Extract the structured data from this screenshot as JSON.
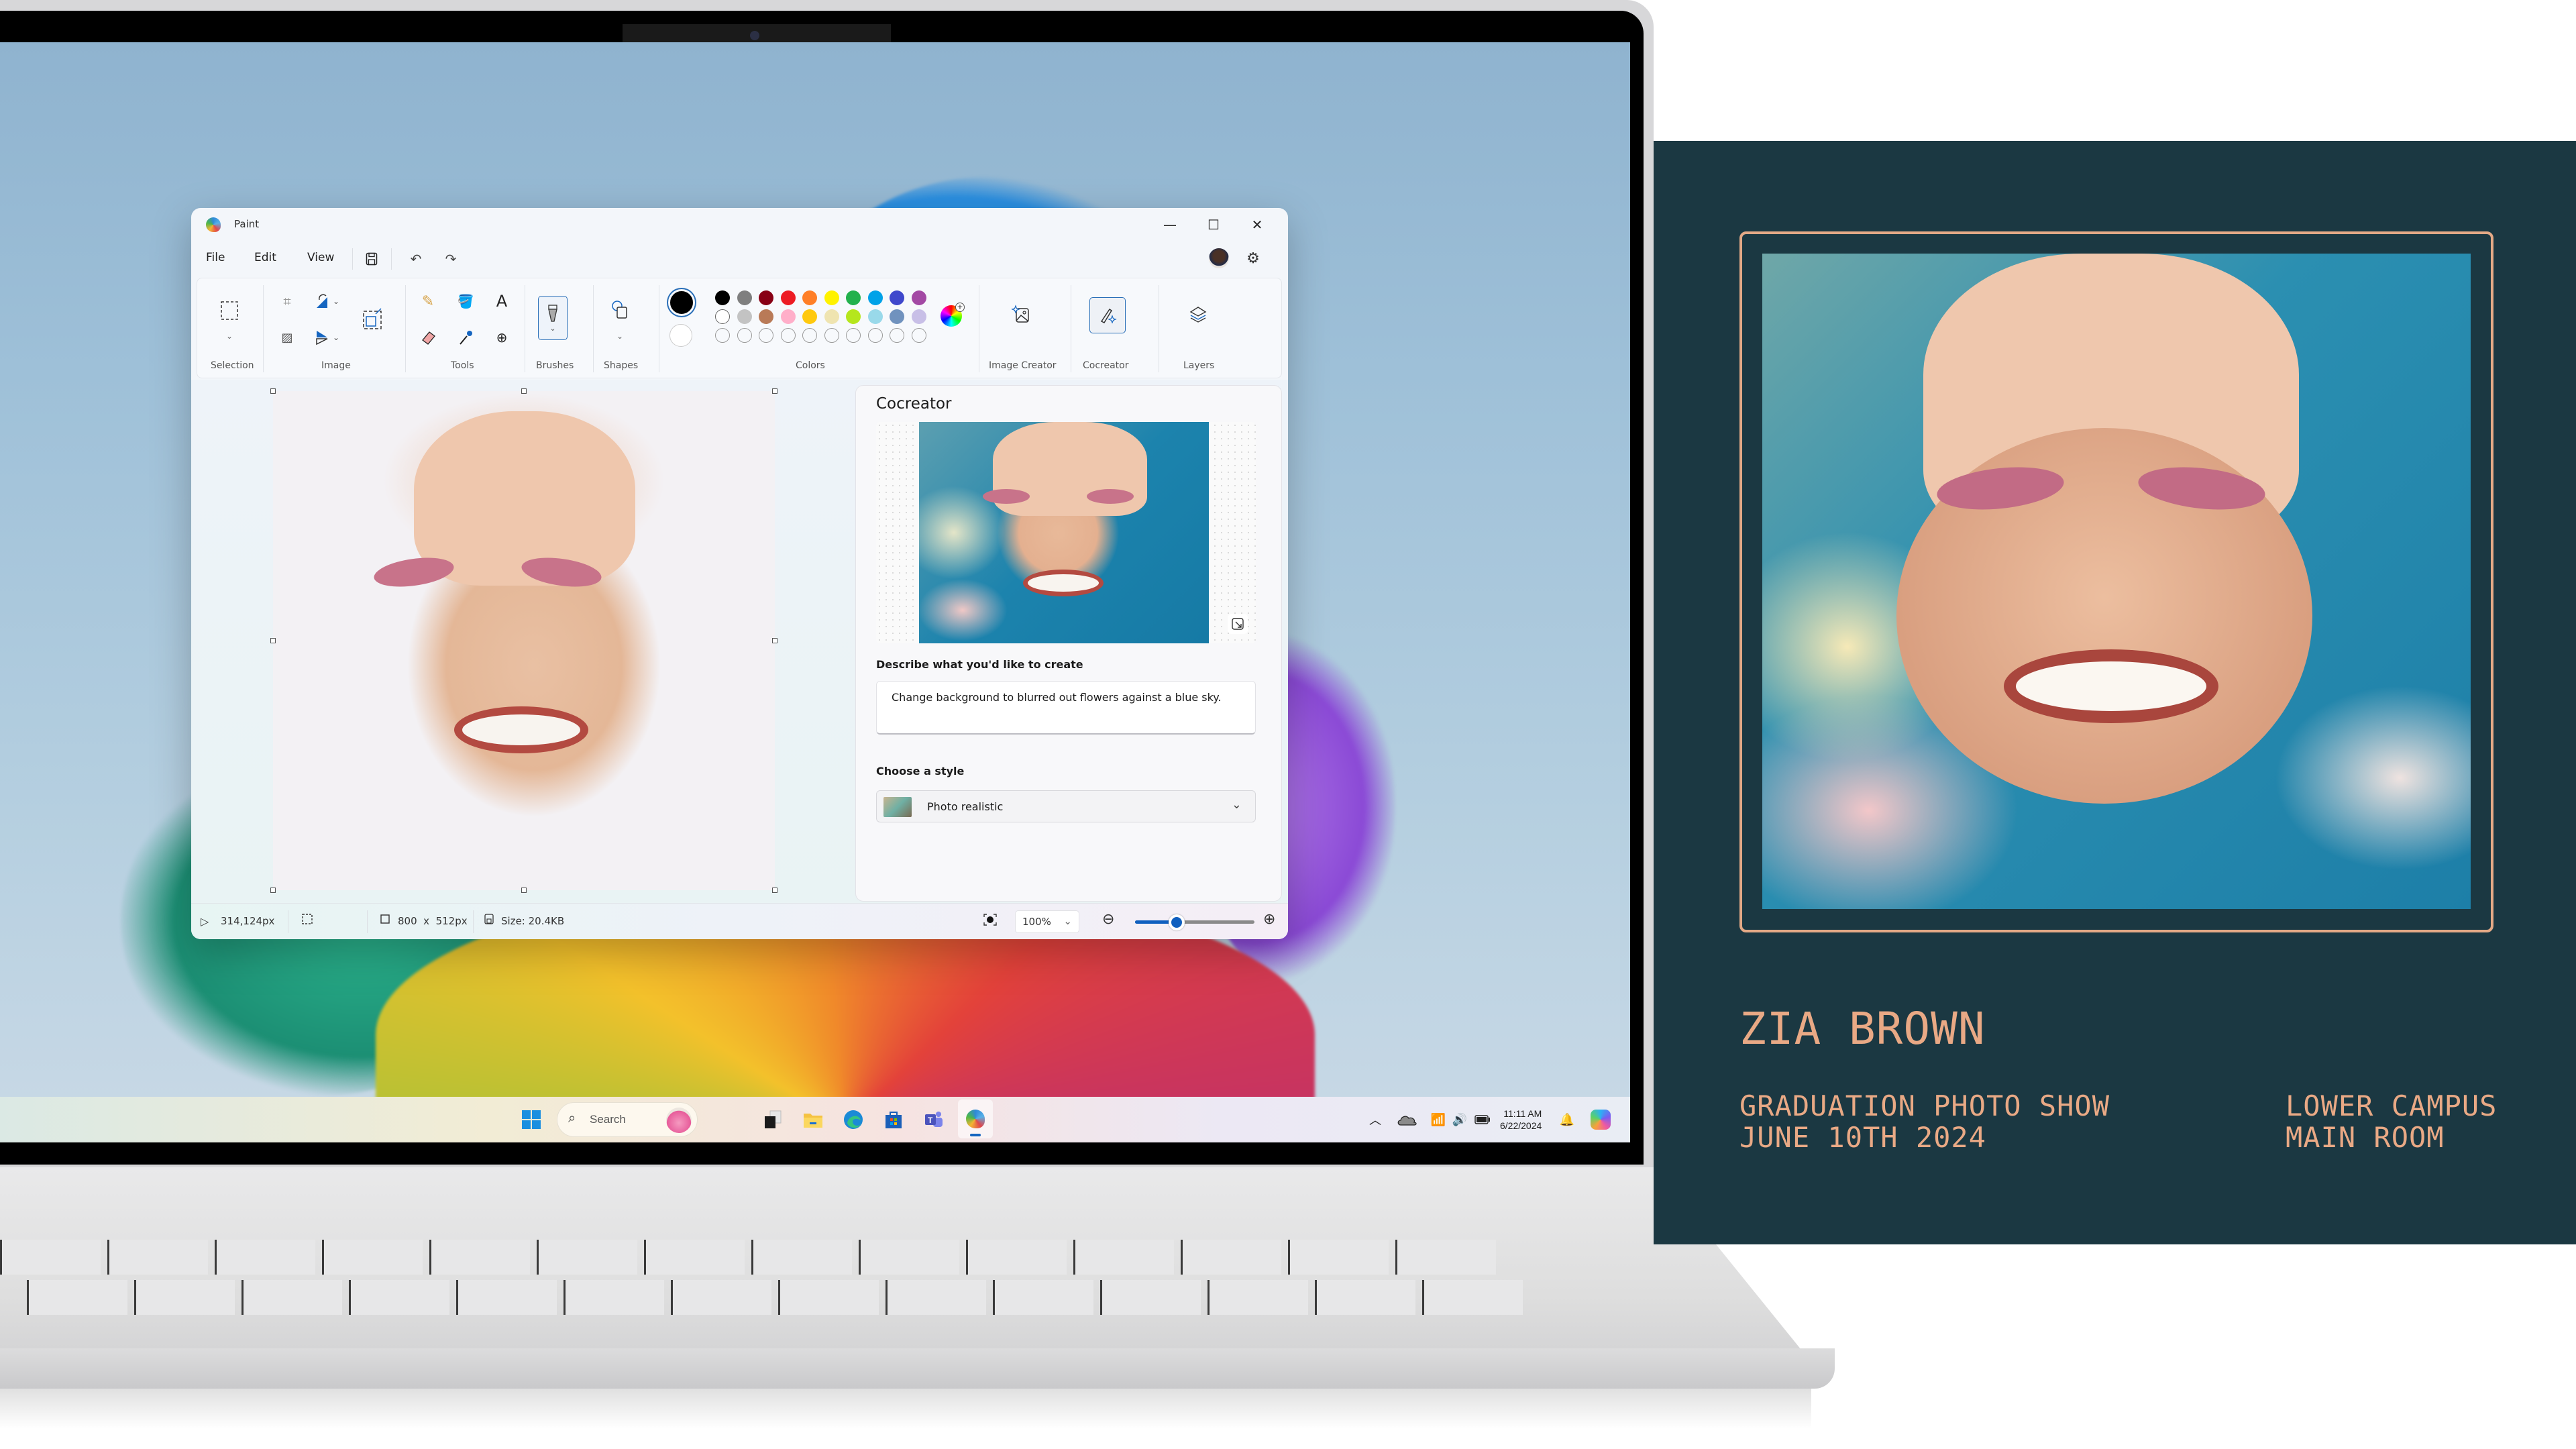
{
  "paint": {
    "app_title": "Paint",
    "window_controls": {
      "minimize": "—",
      "maximize": "☐",
      "close": "✕"
    },
    "menu": [
      "File",
      "Edit",
      "View"
    ],
    "ribbon_groups": {
      "selection": "Selection",
      "image": "Image",
      "tools": "Tools",
      "brushes": "Brushes",
      "shapes": "Shapes",
      "colors": "Colors",
      "image_creator": "Image Creator",
      "cocreator": "Cocreator",
      "layers": "Layers"
    },
    "palette": {
      "primary": "#000000",
      "secondary": "#ffffff",
      "row1": [
        "#000000",
        "#7f7f7f",
        "#880015",
        "#ed1c24",
        "#ff7f27",
        "#fff200",
        "#22b14c",
        "#00a2e8",
        "#3f48cc",
        "#a349a4"
      ],
      "row2": [
        "#ffffff",
        "#c3c3c3",
        "#b97a57",
        "#ffaec9",
        "#ffc90e",
        "#efe4b0",
        "#b5e61d",
        "#99d9ea",
        "#7092be",
        "#c8bfe7"
      ],
      "custom_slots": 10
    },
    "cocreator_panel": {
      "title": "Cocreator",
      "describe_label": "Describe what you'd like to create",
      "prompt_value": "Change background to blurred out flowers against a blue sky.",
      "style_label": "Choose a style",
      "style_value": "Photo realistic"
    },
    "status": {
      "cursor_position": "314,124px",
      "canvas_size": "800  x  512px",
      "file_size": "Size: 20.4KB",
      "zoom_level": "100%",
      "zoom_slider_fraction": 0.35
    }
  },
  "taskbar": {
    "search_placeholder": "Search",
    "time": "11:11 AM",
    "date": "6/22/2024",
    "pinned": [
      "start",
      "search",
      "task-view",
      "file-explorer",
      "edge",
      "microsoft-store",
      "teams",
      "paint"
    ],
    "active_app": "paint"
  },
  "poster": {
    "name": "ZIA BROWN",
    "event_line1": "GRADUATION PHOTO SHOW",
    "event_line2": "JUNE 10TH 2024",
    "location_line1": "LOWER CAMPUS",
    "location_line2": "MAIN ROOM",
    "colors": {
      "background": "#1b3842",
      "accent": "#e9a985"
    }
  }
}
